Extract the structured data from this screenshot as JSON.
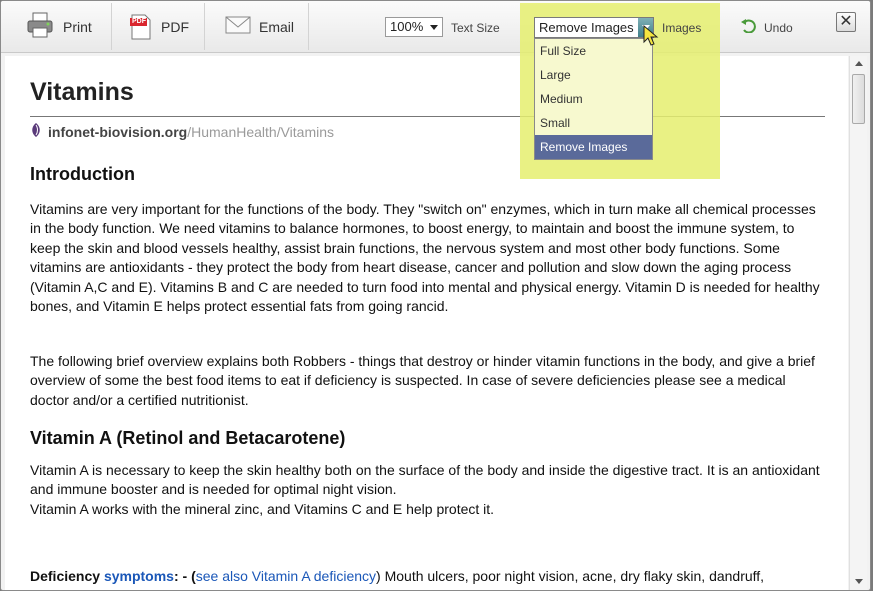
{
  "toolbar": {
    "print_label": "Print",
    "pdf_label": "PDF",
    "pdf_icon_text": "PDF",
    "email_label": "Email",
    "zoom_value": "100%",
    "text_size_label": "Text Size",
    "images_select_value": "Remove Images",
    "images_label": "Images",
    "undo_label": "Undo",
    "close_glyph": "✕"
  },
  "images_dropdown": {
    "options": [
      "Full Size",
      "Large",
      "Medium",
      "Small",
      "Remove Images"
    ],
    "selected": "Remove Images"
  },
  "highlight_color": "#e5ef6e",
  "article": {
    "title": "Vitamins",
    "source_domain": "infonet-biovision.org",
    "source_path": "/HumanHealth/Vitamins",
    "intro_heading": "Introduction",
    "intro_p1": "Vitamins are very important for the functions of the body. They \"switch on\" enzymes, which in turn make all chemical processes in the body function. We need vitamins to balance hormones, to boost energy, to maintain and boost the immune system, to keep the skin and blood vessels healthy, assist brain functions, the nervous system and most other body functions. Some vitamins are antioxidants - they protect the body from heart disease, cancer and pollution and slow down the aging process (Vitamin A,C and E). Vitamins B and C are needed to turn food into mental and physical energy. Vitamin D is needed for healthy bones, and Vitamin E helps protect essential fats from going rancid.",
    "intro_p2": "The following brief overview explains both Robbers - things that destroy or hinder vitamin functions in the body, and give a brief overview of some the best food items to eat if deficiency is suspected. In case of severe deficiencies please see a medical doctor and/or a certified nutritionist.",
    "vita_heading": "Vitamin A (Retinol and Betacarotene)",
    "vita_p1_line1": "Vitamin A is necessary to keep the skin healthy both on the surface of the body and inside the digestive tract. It is an antioxidant and immune booster and is needed for optimal night vision.",
    "vita_p1_line2": "Vitamin A works with the mineral zinc, and Vitamins C and E help protect it.",
    "deficiency_label": "Deficiency",
    "symptoms_link": "symptoms",
    "deficiency_sep": ": - (",
    "see_also_link": "see also Vitamin A deficiency",
    "deficiency_text": ") Mouth ulcers, poor night vision, acne, dry flaky skin, dandruff,"
  }
}
